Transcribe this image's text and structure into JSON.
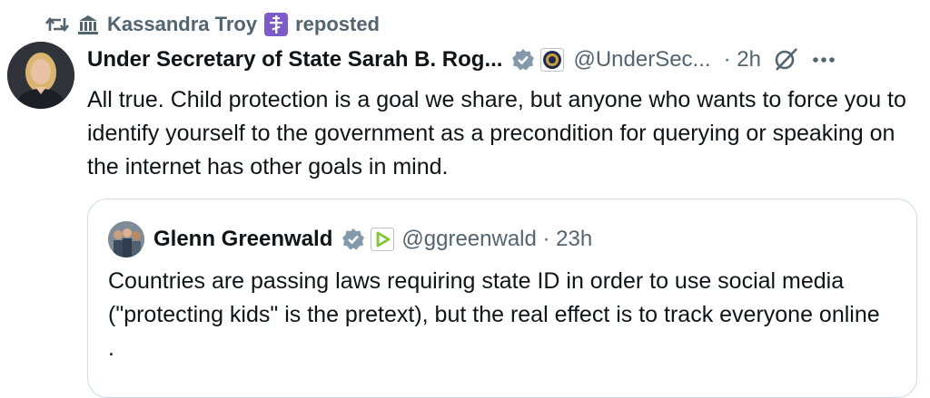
{
  "repost": {
    "icon": "repost-icon",
    "user_name": "Kassandra Troy",
    "user_badge_icon": "orthodox-cross-icon",
    "label": "reposted"
  },
  "tweet": {
    "author_name": "Under Secretary of State Sarah B. Rog...",
    "verified_icon": "verified-badge-icon",
    "affiliation_icon": "state-department-seal-icon",
    "handle": "@UnderSec...",
    "time": "· 2h",
    "text": "All true. Child protection is a goal we share, but anyone who wants to force you to identify yourself to the government as a precondition for querying or speaking on the internet has other goals in mind."
  },
  "quote": {
    "author_name": "Glenn Greenwald",
    "verified_icon": "verified-badge-icon",
    "affiliation_icon": "rumble-icon",
    "handle": "@ggreenwald · 23h",
    "text": "Countries are passing laws requiring state ID in order to use social media (\"protecting kids\" is the pretext), but the real effect is to track everyone online ."
  },
  "colors": {
    "text": "#0f1419",
    "secondary": "#536471",
    "verified": "#829aab",
    "border": "#cfd9de",
    "badge_purple": "#7b5cc8",
    "rumble_green": "#85c742"
  }
}
